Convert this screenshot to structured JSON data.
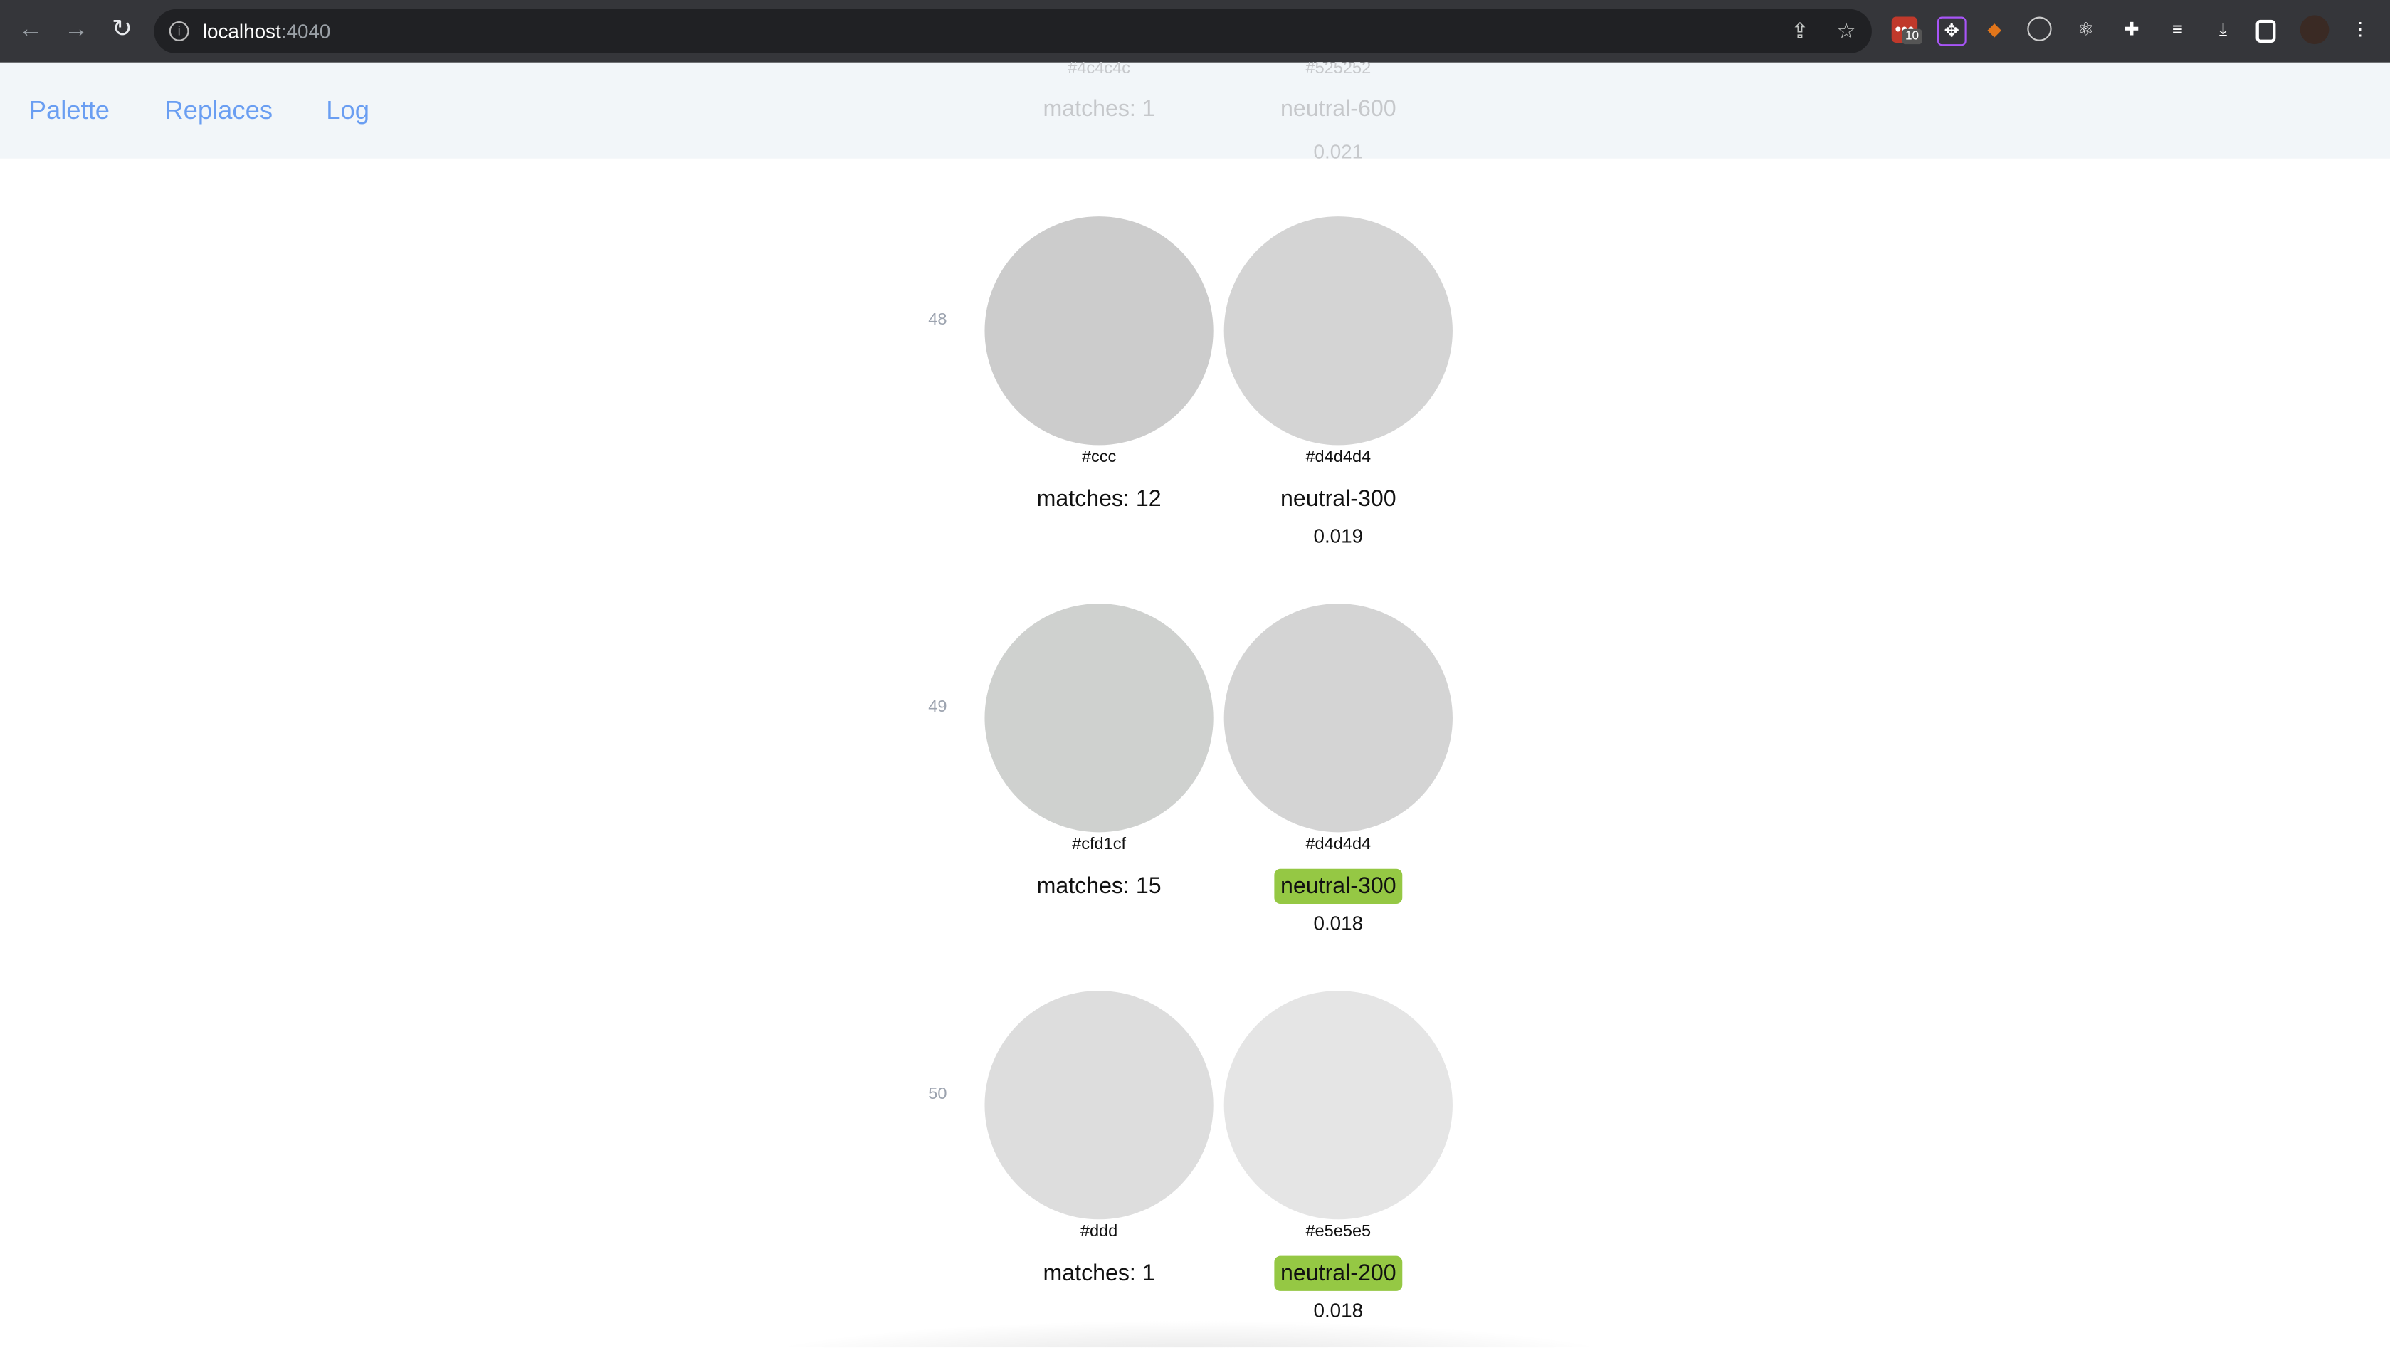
{
  "browser": {
    "url_host": "localhost",
    "url_port": ":4040",
    "extension_badge": "10"
  },
  "nav": {
    "links": [
      "Palette",
      "Replaces",
      "Log"
    ]
  },
  "ghost_row": {
    "left_hex": "#4c4c4c",
    "right_hex": "#525252",
    "matches": "matches: 1",
    "name": "neutral-600",
    "value": "0.021"
  },
  "rows": [
    {
      "index": "48",
      "left_hex": "#ccc",
      "left_color": "#cccccc",
      "matches": "matches: 12",
      "right_hex": "#d4d4d4",
      "right_color": "#d4d4d4",
      "name": "neutral-300",
      "highlighted": false,
      "value": "0.019"
    },
    {
      "index": "49",
      "left_hex": "#cfd1cf",
      "left_color": "#cfd1cf",
      "matches": "matches: 15",
      "right_hex": "#d4d4d4",
      "right_color": "#d4d4d4",
      "name": "neutral-300",
      "highlighted": true,
      "value": "0.018"
    },
    {
      "index": "50",
      "left_hex": "#ddd",
      "left_color": "#dddddd",
      "matches": "matches: 1",
      "right_hex": "#e5e5e5",
      "right_color": "#e5e5e5",
      "name": "neutral-200",
      "highlighted": true,
      "value": "0.018"
    }
  ],
  "colors": {
    "highlight": "#95c844",
    "link": "#6a9ef2",
    "header_bg": "#f1f5f9"
  }
}
